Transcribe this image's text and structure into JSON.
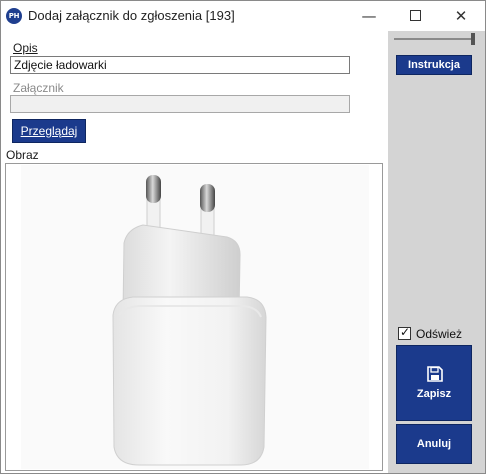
{
  "window": {
    "app_icon_text": "PH",
    "title": "Dodaj załącznik do zgłoszenia [193]",
    "minimize_glyph": "—",
    "close_glyph": "✕"
  },
  "form": {
    "opis_label": "Opis",
    "opis_value": "Zdjęcie ładowarki",
    "zalacznik_label": "Załącznik",
    "zalacznik_value": "",
    "browse_button": "Przeglądaj",
    "image_label": "Obraz"
  },
  "side": {
    "instrukcja_button": "Instrukcja",
    "refresh_label": "Odśwież",
    "refresh_checked": true,
    "save_button": "Zapisz",
    "cancel_button": "Anuluj",
    "check_glyph": "✓"
  },
  "icons": {
    "app": "app-logo-icon",
    "save": "floppy-disk-icon",
    "check": "checkmark-icon",
    "image": "usb-c-charger-photo"
  },
  "colors": {
    "accent": "#1b3a8c",
    "side_panel": "#d4d4d4"
  }
}
